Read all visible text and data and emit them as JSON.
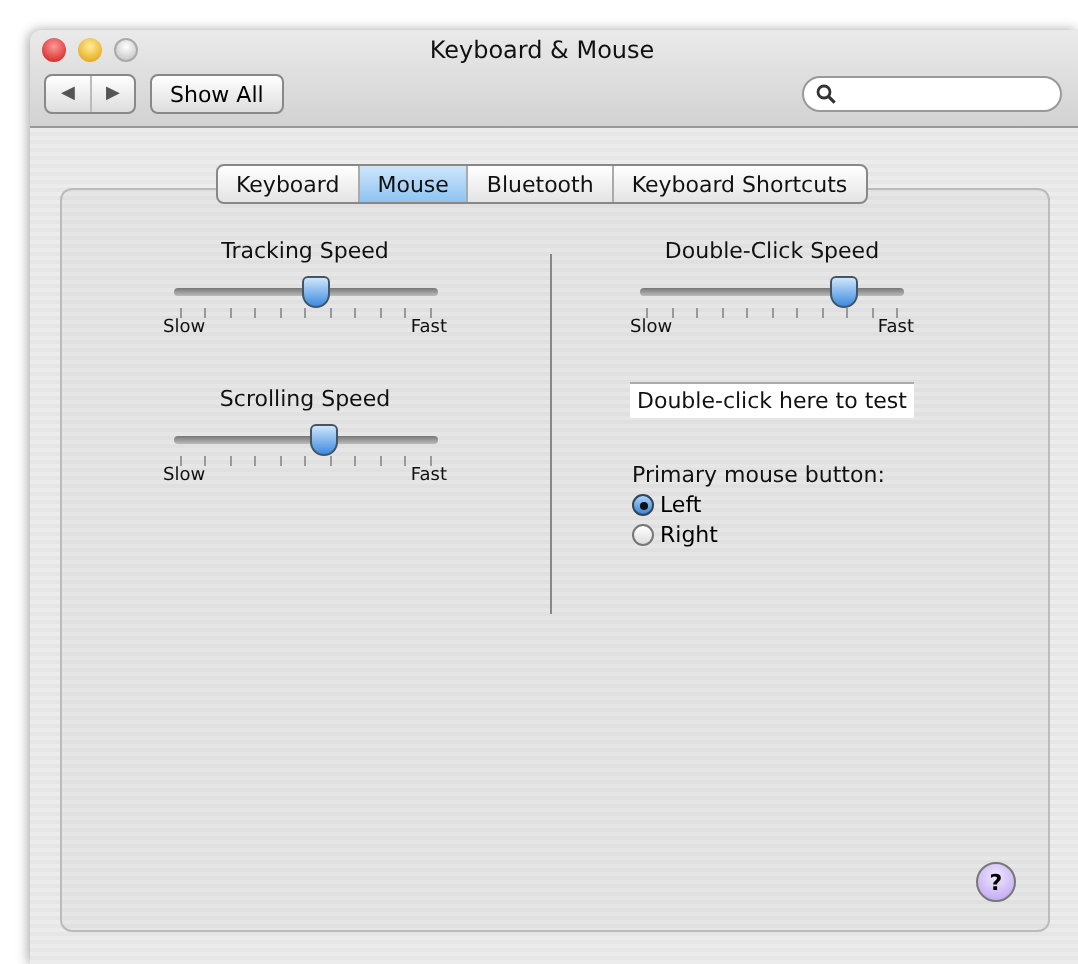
{
  "window": {
    "title": "Keyboard & Mouse"
  },
  "toolbar": {
    "back": "◀",
    "forward": "▶",
    "show_all": "Show All"
  },
  "tabs": [
    {
      "label": "Keyboard",
      "selected": false
    },
    {
      "label": "Mouse",
      "selected": true
    },
    {
      "label": "Bluetooth",
      "selected": false
    },
    {
      "label": "Keyboard Shortcuts",
      "selected": false
    }
  ],
  "left_sliders": [
    {
      "title": "Tracking Speed",
      "level": 0.54,
      "min_label": "Slow",
      "max_label": "Fast"
    },
    {
      "title": "Scrolling Speed",
      "level": 0.57,
      "min_label": "Slow",
      "max_label": "Fast"
    }
  ],
  "double_click": {
    "title": "Double-Click Speed",
    "level": 0.77,
    "min_label": "Slow",
    "max_label": "Fast",
    "test_area": "Double-click here to test"
  },
  "primary_button": {
    "label": "Primary mouse button:",
    "options": [
      {
        "label": "Left",
        "selected": true
      },
      {
        "label": "Right",
        "selected": false
      }
    ]
  },
  "help": "?"
}
